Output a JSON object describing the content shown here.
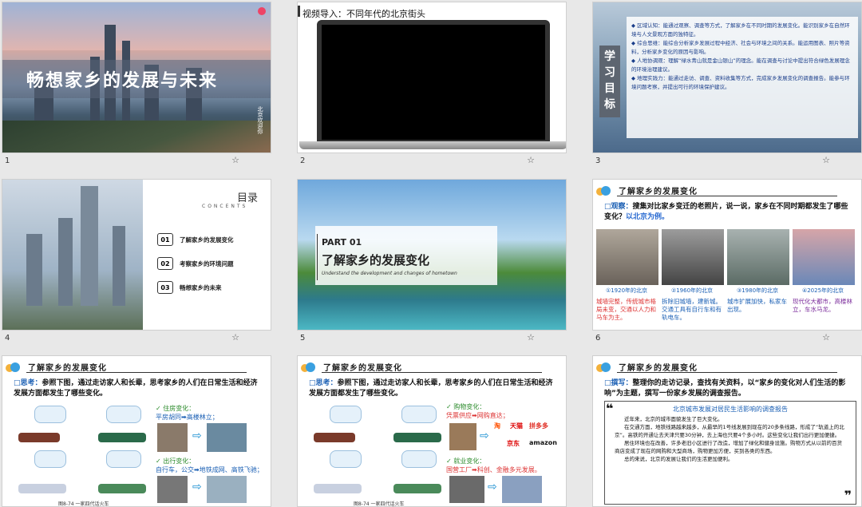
{
  "slides": [
    {
      "num": "1",
      "title": "畅想家乡的发展与未来",
      "side_text": "北京欢迎你"
    },
    {
      "num": "2",
      "title": "视频导入：不同年代的北京街头"
    },
    {
      "num": "3",
      "side_title": "学习目标",
      "goals": [
        "◆ 区域认知：能通过观察、调查等方式，了解家乡在不同时期的发展变化。能识别家乡在自然环境与人文景观方面的独特征。",
        "◆ 综合思维：能综合分析家乡发展过程中经济、社会与环境之间的关系。能运用图表、照片等资料，分析家乡变化的原因与影响。",
        "◆ 人地协调观：理解“绿水青山就是金山银山”的理念。能在调查与讨论中提出符合绿色发展理念的环境治理建议。",
        "◆ 地理实践力：能通过走访、调查、资料收集等方式，完成家乡发展变化的调查报告。能参与环境问题考察，并提出可行的环境保护建议。"
      ]
    },
    {
      "num": "4",
      "logo": "目录",
      "contents": "CONCENTS",
      "items": [
        {
          "n": "01",
          "t": "了解家乡的发展变化"
        },
        {
          "n": "02",
          "t": "考察家乡的环境问题"
        },
        {
          "n": "03",
          "t": "畅想家乡的未来"
        }
      ]
    },
    {
      "num": "5",
      "part": "PART 01",
      "title": "了解家乡的发展变化",
      "subtitle": "Understand the development and changes of hometown"
    },
    {
      "num": "6",
      "header": "了解家乡的发展变化",
      "q_label": "□观察：",
      "question": "搜集对比家乡变迁的老照片，说一说，家乡在不同时期都发生了哪些变化？",
      "question_tail": "以北京为例。",
      "photos": [
        {
          "cap": "①1920年的北京",
          "desc": "城墙完整，传统城市格局未变，交通以人力和马车为主。"
        },
        {
          "cap": "②1960年的北京",
          "desc": "拆除旧城墙，建新城。交通工具有自行车和有轨电车。"
        },
        {
          "cap": "③1980年的北京",
          "desc": "城市扩展加快，私家车出现。"
        },
        {
          "cap": "④2025年的北京",
          "desc": "现代化大都市，高楼林立，车水马龙。"
        }
      ]
    },
    {
      "num": "7",
      "header": "了解家乡的发展变化",
      "q_label": "□思考：",
      "question": "参照下图，通过走访家人和长辈，思考家乡的人们在日常生活和经济发展方面都发生了哪些变化。",
      "changes": [
        {
          "title": "✓ 住房变化：",
          "text": "平房胡同➡高楼林立；"
        },
        {
          "title": "✓ 出行变化：",
          "text": "自行车，公交➡地铁成网、高铁飞驰；"
        }
      ],
      "figcap": "图8-74  一家四代话火车"
    },
    {
      "num": "8",
      "header": "了解家乡的发展变化",
      "q_label": "□思考：",
      "question": "参照下图，通过走访家人和长辈，思考家乡的人们在日常生活和经济发展方面都发生了哪些变化。",
      "changes": [
        {
          "title": "✓ 购物变化：",
          "text": "凭票供应➡网购直达；"
        },
        {
          "title": "✓ 就业变化：",
          "text": "国营工厂➡科创、金融多元发展。"
        }
      ],
      "figcap": "图8-74  一家四代话火车",
      "logos": [
        "淘",
        "天猫",
        "京东",
        "拼多多",
        "amazon"
      ]
    },
    {
      "num": "9",
      "header": "了解家乡的发展变化",
      "q_label": "□撰写：",
      "question": "整理你的走访记录，查找有关资料，以“家乡的变化对人们生活的影响”为主题，撰写一份家乡发展的调查报告。",
      "report_title": "北京城市发展对居民生活影响的调查报告",
      "paras": [
        "近年来，北京的城市面貌发生了巨大变化。",
        "在交通方面，地铁线路越来越多，从最早的1号线发展到现在的20多条线路，形成了“轨道上的北京”。高铁的开通让去天津只要30分钟，去上海也只要4个多小时。这些变化让我们出行更加便捷。",
        "居住环境也在改善，许多老旧小区进行了改造，增加了绿化和健身设施。购物方式从以前的百货商店变成了现在的网购和大型商场，购物更加方便，买到各类的东西。",
        "总的来说，北京的发展让我们的生活更加便利。"
      ]
    }
  ],
  "star": "☆"
}
